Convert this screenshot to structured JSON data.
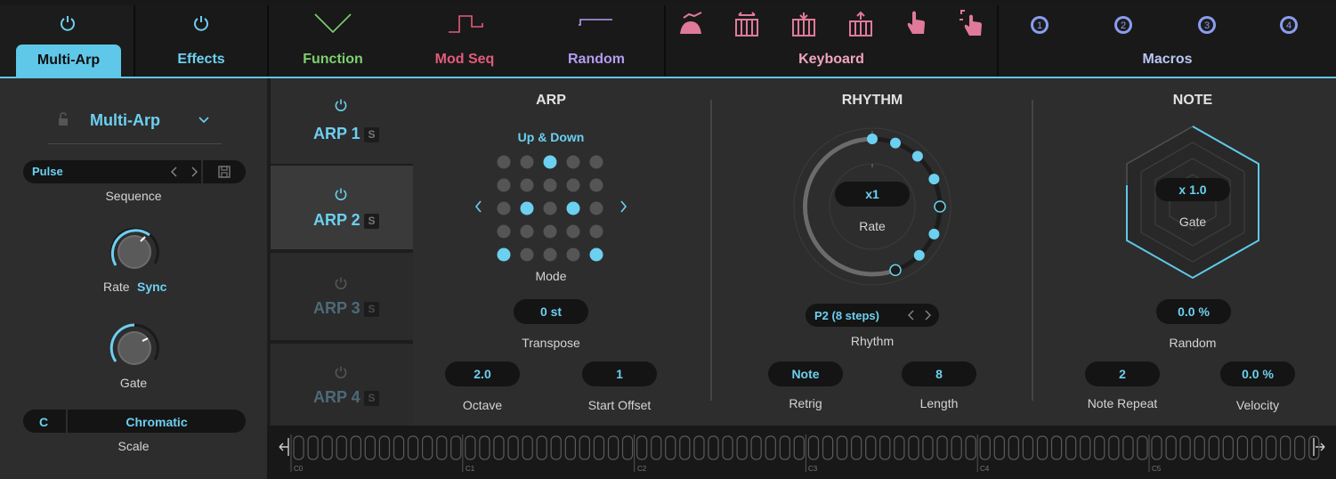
{
  "topbar": {
    "tabs": [
      {
        "label": "Multi-Arp",
        "color": "#0f0f10"
      },
      {
        "label": "Effects",
        "color": "#6cd0f0"
      },
      {
        "label": "Function",
        "color": "#7ed06e"
      },
      {
        "label": "Mod Seq",
        "color": "#e25b7a"
      },
      {
        "label": "Random",
        "color": "#b39cf0"
      },
      {
        "label": "Keyboard",
        "color": "#f0a5c0"
      },
      {
        "label": "Macros",
        "color": "#b9c7f5"
      }
    ],
    "macros": [
      "1",
      "2",
      "3",
      "4"
    ],
    "colors": {
      "accent": "#5fc8e8",
      "function": "#7ed06e",
      "modseq": "#e25b7a",
      "random": "#b39cf0",
      "keyboard": "#e07a9a",
      "macros": "#8a9df0"
    }
  },
  "left": {
    "preset_name": "Multi-Arp",
    "sequence_value": "Pulse",
    "sequence_label": "Sequence",
    "rate_label": "Rate",
    "rate_mode": "Sync",
    "gate_label": "Gate",
    "scale_root": "C",
    "scale_type": "Chromatic",
    "scale_label": "Scale"
  },
  "arps": [
    {
      "name": "ARP 1",
      "solo": "S"
    },
    {
      "name": "ARP 2",
      "solo": "S"
    },
    {
      "name": "ARP 3",
      "solo": "S"
    },
    {
      "name": "ARP 4",
      "solo": "S"
    }
  ],
  "arp": {
    "heading": "ARP",
    "mode_value": "Up & Down",
    "mode_label": "Mode",
    "transpose_value": "0 st",
    "transpose_label": "Transpose",
    "octave_value": "2.0",
    "octave_label": "Octave",
    "start_offset_value": "1",
    "start_offset_label": "Start Offset"
  },
  "rhythm": {
    "heading": "RHYTHM",
    "rate_value": "x1",
    "rate_label": "Rate",
    "pattern_value": "P2 (8 steps)",
    "pattern_label": "Rhythm",
    "retrig_value": "Note",
    "retrig_label": "Retrig",
    "length_value": "8",
    "length_label": "Length"
  },
  "note": {
    "heading": "NOTE",
    "gate_value": "x 1.0",
    "gate_label": "Gate",
    "random_value": "0.0 %",
    "random_label": "Random",
    "repeat_value": "2",
    "repeat_label": "Note Repeat",
    "velocity_value": "0.0 %",
    "velocity_label": "Velocity"
  },
  "keyboard": {
    "octaves": [
      "C0",
      "C1",
      "C2",
      "C3",
      "C4",
      "C5"
    ]
  }
}
